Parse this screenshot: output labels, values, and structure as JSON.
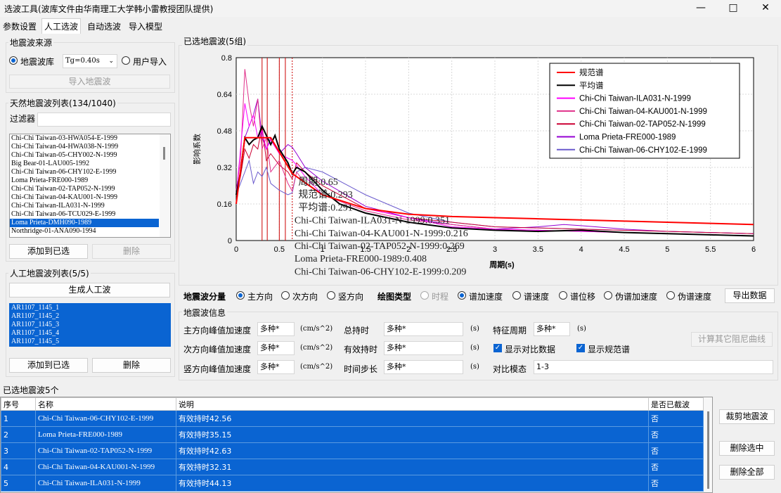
{
  "window": {
    "title": "选波工具(波库文件由华南理工大学韩小雷教授团队提供)"
  },
  "tabs": [
    "参数设置",
    "人工选波",
    "自动选波",
    "导入模型"
  ],
  "source": {
    "title": "地震波来源",
    "opt_lib": "地震波库",
    "tg": "Tg=0.40s",
    "opt_user": "用户导入",
    "import_btn": "导入地震波"
  },
  "natural": {
    "title": "天然地震波列表(134/1040)",
    "filter_label": "过滤器",
    "filter_value": "",
    "items": [
      "Chi-Chi Taiwan-03-HWA054-E-1999",
      "Chi-Chi Taiwan-04-HWA038-N-1999",
      "Chi-Chi Taiwan-05-CHY002-N-1999",
      "Big Bear-01-LAU005-1992",
      "Chi-Chi Taiwan-06-CHY102-E-1999",
      "Loma Prieta-FRE000-1989",
      "Chi-Chi Taiwan-02-TAP052-N-1999",
      "Chi-Chi Taiwan-04-KAU001-N-1999",
      "Chi-Chi Taiwan-ILA031-N-1999",
      "Chi-Chi Taiwan-06-TCU029-E-1999",
      "Loma Prieta-DMH090-1989",
      "Northridge-01-ANA090-1994"
    ],
    "selected_index": 10,
    "add_btn": "添加到已选",
    "del_btn": "删除"
  },
  "artificial": {
    "title": "人工地震波列表(5/5)",
    "gen_btn": "生成人工波",
    "items": [
      "AR1107_1145_1",
      "AR1107_1145_2",
      "AR1107_1145_3",
      "AR1107_1145_4",
      "AR1107_1145_5"
    ],
    "add_btn": "添加到已选",
    "del_btn": "删除"
  },
  "chart_group": {
    "title": "已选地震波(5组)"
  },
  "chart_data": {
    "type": "line",
    "ylabel": "影响系数",
    "xlabel": "周期(s)",
    "xlim": [
      0,
      6
    ],
    "ylim": [
      0,
      0.8
    ],
    "xticks": [
      "0",
      "0.5",
      "1",
      "1.5",
      "2",
      "2.5",
      "3",
      "3.5",
      "4",
      "4.5",
      "5",
      "5.5",
      "6"
    ],
    "yticks": [
      "0",
      "0.16",
      "0.32",
      "0.48",
      "0.64",
      "0.8"
    ],
    "grid": true,
    "legend_position": "top-right",
    "series": [
      {
        "name": "规范谱",
        "color": "#ff0000",
        "width": 2,
        "x": [
          0,
          0.1,
          0.4,
          0.65,
          1,
          1.5,
          2,
          2.5,
          3,
          3.5,
          4,
          4.5,
          5,
          5.5,
          6
        ],
        "y": [
          0.16,
          0.45,
          0.45,
          0.293,
          0.2,
          0.14,
          0.115,
          0.105,
          0.1,
          0.095,
          0.09,
          0.085,
          0.08,
          0.075,
          0.07
        ]
      },
      {
        "name": "平均谱",
        "color": "#000000",
        "width": 2,
        "x": [
          0,
          0.05,
          0.1,
          0.15,
          0.2,
          0.25,
          0.3,
          0.35,
          0.4,
          0.45,
          0.5,
          0.55,
          0.6,
          0.65,
          0.7,
          0.8,
          0.9,
          1,
          1.2,
          1.5,
          2,
          2.5,
          3,
          3.5,
          4,
          4.5,
          5,
          5.5,
          6
        ],
        "y": [
          0.2,
          0.3,
          0.45,
          0.42,
          0.44,
          0.45,
          0.5,
          0.46,
          0.42,
          0.46,
          0.4,
          0.37,
          0.34,
          0.291,
          0.32,
          0.3,
          0.26,
          0.22,
          0.16,
          0.12,
          0.08,
          0.055,
          0.045,
          0.04,
          0.045,
          0.035,
          0.03,
          0.025,
          0.02
        ]
      },
      {
        "name": "Chi-Chi Taiwan-ILA031-N-1999",
        "color": "#ff00ff",
        "width": 1,
        "x": [
          0,
          0.05,
          0.1,
          0.15,
          0.2,
          0.25,
          0.3,
          0.35,
          0.4,
          0.5,
          0.6,
          0.65,
          0.7,
          0.8,
          1,
          1.5,
          2,
          2.5,
          3,
          4,
          5,
          6
        ],
        "y": [
          0.2,
          0.4,
          0.6,
          0.5,
          0.55,
          0.45,
          0.48,
          0.4,
          0.44,
          0.38,
          0.36,
          0.351,
          0.33,
          0.28,
          0.2,
          0.14,
          0.1,
          0.06,
          0.05,
          0.04,
          0.03,
          0.02
        ]
      },
      {
        "name": "Chi-Chi Taiwan-04-KAU001-N-1999",
        "color": "#e0308a",
        "width": 1,
        "x": [
          0,
          0.05,
          0.1,
          0.15,
          0.2,
          0.25,
          0.3,
          0.35,
          0.4,
          0.5,
          0.6,
          0.65,
          0.7,
          0.8,
          1,
          1.5,
          2,
          2.5,
          3,
          4,
          5,
          6
        ],
        "y": [
          0.22,
          0.35,
          0.75,
          0.6,
          0.5,
          0.62,
          0.4,
          0.45,
          0.3,
          0.35,
          0.25,
          0.216,
          0.3,
          0.25,
          0.2,
          0.13,
          0.09,
          0.07,
          0.05,
          0.04,
          0.03,
          0.02
        ]
      },
      {
        "name": "Chi-Chi Taiwan-02-TAP052-N-1999",
        "color": "#cc0033",
        "width": 1,
        "x": [
          0,
          0.05,
          0.1,
          0.15,
          0.2,
          0.25,
          0.3,
          0.35,
          0.4,
          0.5,
          0.6,
          0.65,
          0.7,
          0.8,
          1,
          1.5,
          2,
          2.5,
          3,
          4,
          5,
          6
        ],
        "y": [
          0.2,
          0.28,
          0.4,
          0.36,
          0.42,
          0.4,
          0.5,
          0.35,
          0.38,
          0.33,
          0.3,
          0.269,
          0.34,
          0.3,
          0.24,
          0.14,
          0.1,
          0.08,
          0.06,
          0.05,
          0.04,
          0.03
        ]
      },
      {
        "name": "Loma Prieta-FRE000-1989",
        "color": "#9400d3",
        "width": 1,
        "x": [
          0,
          0.05,
          0.1,
          0.15,
          0.2,
          0.25,
          0.3,
          0.35,
          0.4,
          0.5,
          0.6,
          0.65,
          0.7,
          0.8,
          1,
          1.5,
          2,
          2.5,
          3,
          3.5,
          3.8,
          4,
          4.5,
          5,
          5.5,
          6
        ],
        "y": [
          0.2,
          0.3,
          0.45,
          0.5,
          0.55,
          0.62,
          0.45,
          0.4,
          0.45,
          0.38,
          0.42,
          0.408,
          0.38,
          0.32,
          0.26,
          0.15,
          0.1,
          0.07,
          0.05,
          0.06,
          0.07,
          0.065,
          0.05,
          0.04,
          0.035,
          0.03
        ]
      },
      {
        "name": "Chi-Chi Taiwan-06-CHY102-E-1999",
        "color": "#6a5acd",
        "width": 1,
        "x": [
          0,
          0.05,
          0.1,
          0.15,
          0.2,
          0.25,
          0.3,
          0.35,
          0.4,
          0.5,
          0.6,
          0.65,
          0.7,
          0.8,
          1,
          1.5,
          2,
          2.5,
          3,
          4,
          5,
          6
        ],
        "y": [
          0.2,
          0.25,
          0.3,
          0.35,
          0.25,
          0.3,
          0.28,
          0.32,
          0.25,
          0.22,
          0.2,
          0.209,
          0.3,
          0.32,
          0.3,
          0.2,
          0.12,
          0.08,
          0.06,
          0.05,
          0.04,
          0.03
        ]
      }
    ],
    "vlines": [
      {
        "x": 0.3,
        "color": "#cc0000"
      },
      {
        "x": 0.36,
        "color": "#cc0000"
      },
      {
        "x": 0.5,
        "color": "#cc0000"
      },
      {
        "x": 0.57,
        "color": "#cc0000"
      },
      {
        "x": 0.65,
        "color": "#cc0000",
        "dashed": true
      }
    ],
    "cursor_info": [
      "周期:0.65",
      "规范谱:0.293",
      "平均谱:0.291",
      "Chi-Chi Taiwan-ILA031-N-1999:0.351",
      "Chi-Chi Taiwan-04-KAU001-N-1999:0.216",
      "Chi-Chi Taiwan-02-TAP052-N-1999:0.269",
      "Loma Prieta-FRE000-1989:0.408",
      "Chi-Chi Taiwan-06-CHY102-E-1999:0.209"
    ]
  },
  "options": {
    "component_label": "地震波分量",
    "comp": [
      "主方向",
      "次方向",
      "竖方向"
    ],
    "plot_label": "绘图类型",
    "plots": [
      "时程",
      "谱加速度",
      "谱速度",
      "谱位移",
      "伪谱加速度",
      "伪谱速度"
    ],
    "export_btn": "导出数据"
  },
  "info": {
    "title": "地震波信息",
    "main_pga": "主方向峰值加速度",
    "sec_pga": "次方向峰值加速度",
    "ver_pga": "竖方向峰值加速度",
    "v_multi": "多种*",
    "unit_acc": "(cm/s^2)",
    "total_dur": "总持时",
    "eff_dur": "有效持时",
    "dt": "时间步长",
    "unit_s": "(s)",
    "char_period": "特征周期",
    "show_compare": "显示对比数据",
    "show_code": "显示规范谱",
    "compare_modes": "对比模态",
    "compare_value": "1-3",
    "calc_btn": "计算其它阻尼曲线"
  },
  "selected": {
    "title": "已选地震波5个",
    "headers": [
      "序号",
      "名称",
      "说明",
      "是否已截波"
    ],
    "rows": [
      [
        "1",
        "Chi-Chi Taiwan-06-CHY102-E-1999",
        "有效持时42.56",
        "否"
      ],
      [
        "2",
        "Loma Prieta-FRE000-1989",
        "有效持时35.15",
        "否"
      ],
      [
        "3",
        "Chi-Chi Taiwan-02-TAP052-N-1999",
        "有效持时42.63",
        "否"
      ],
      [
        "4",
        "Chi-Chi Taiwan-04-KAU001-N-1999",
        "有效持时32.31",
        "否"
      ],
      [
        "5",
        "Chi-Chi Taiwan-ILA031-N-1999",
        "有效持时44.13",
        "否"
      ]
    ],
    "cut_btn": "裁剪地震波",
    "del_sel_btn": "删除选中",
    "del_all_btn": "删除全部"
  }
}
